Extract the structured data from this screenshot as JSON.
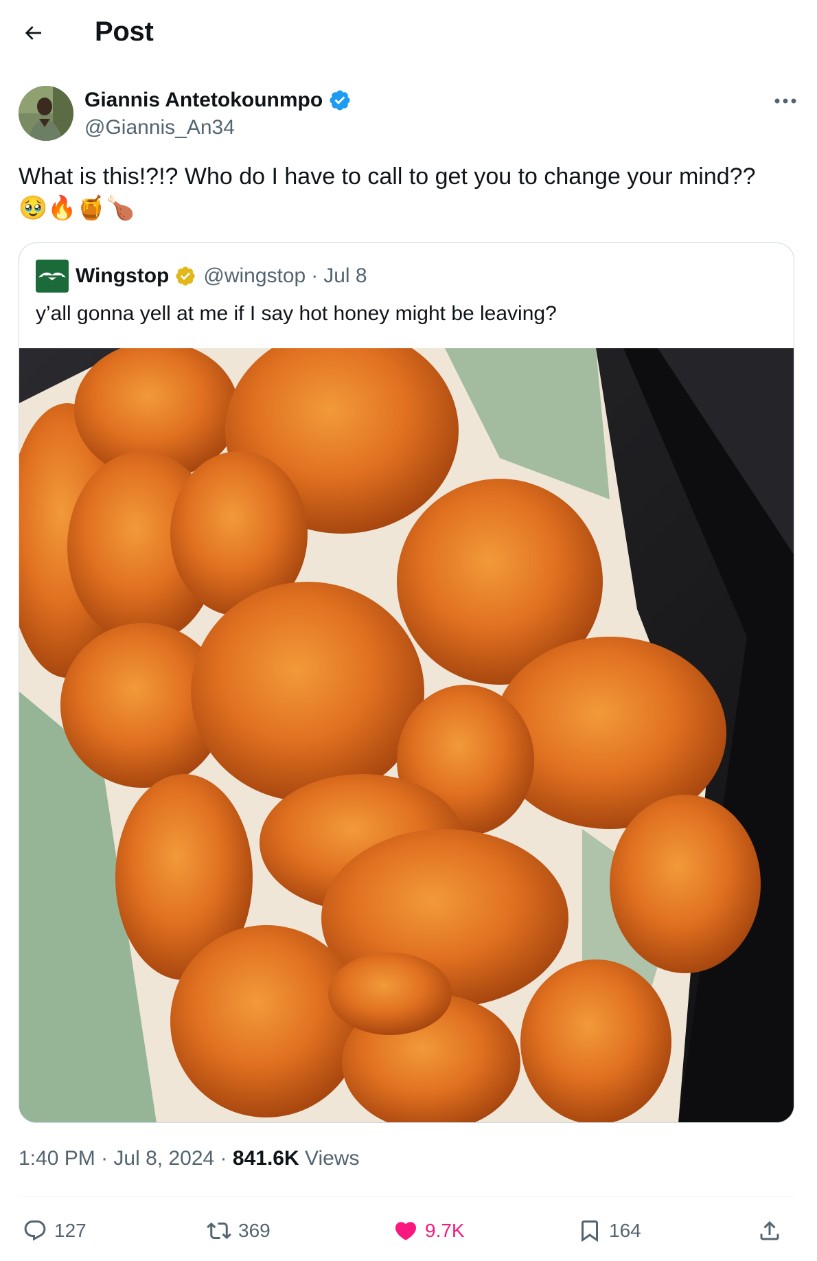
{
  "header": {
    "title": "Post"
  },
  "author": {
    "name": "Giannis Antetokounmpo",
    "handle": "@Giannis_An34"
  },
  "tweet": {
    "text": "What is this!?!? Who do I have to call to get you to change your mind??",
    "emojis": "🥹🔥🍯🍗"
  },
  "quote": {
    "name": "Wingstop",
    "handle": "@wingstop",
    "dot": "·",
    "date": "Jul 8",
    "text": "y’all gonna yell at me if I say hot honey might be leaving?"
  },
  "meta": {
    "time": "1:40 PM",
    "sep1": "·",
    "date": "Jul 8, 2024",
    "sep2": "·",
    "views_count": "841.6K",
    "views_label": "Views"
  },
  "actions": {
    "replies": "127",
    "reposts": "369",
    "likes": "9.7K",
    "bookmarks": "164"
  },
  "colors": {
    "accent": "#1d9bf0",
    "like": "#f91880",
    "muted": "#536471",
    "text": "#0f1419"
  },
  "icons": [
    "back-arrow-icon",
    "verified-badge-icon",
    "more-icon",
    "reply-icon",
    "repost-icon",
    "like-icon",
    "bookmark-icon",
    "share-icon"
  ]
}
